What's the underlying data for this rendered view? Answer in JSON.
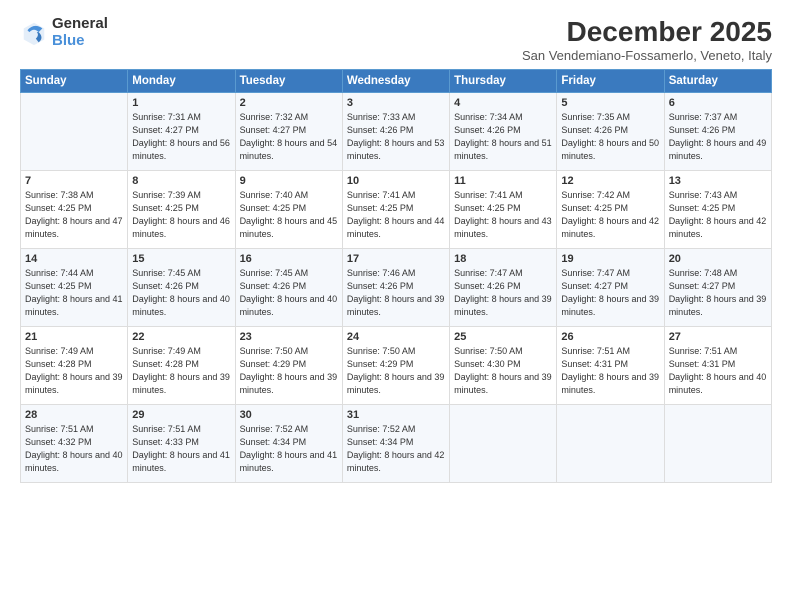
{
  "header": {
    "logo_general": "General",
    "logo_blue": "Blue",
    "month_title": "December 2025",
    "location": "San Vendemiano-Fossamerlo, Veneto, Italy"
  },
  "days_of_week": [
    "Sunday",
    "Monday",
    "Tuesday",
    "Wednesday",
    "Thursday",
    "Friday",
    "Saturday"
  ],
  "weeks": [
    [
      {
        "day": "",
        "sunrise": "",
        "sunset": "",
        "daylight": ""
      },
      {
        "day": "1",
        "sunrise": "7:31 AM",
        "sunset": "4:27 PM",
        "daylight": "8 hours and 56 minutes."
      },
      {
        "day": "2",
        "sunrise": "7:32 AM",
        "sunset": "4:27 PM",
        "daylight": "8 hours and 54 minutes."
      },
      {
        "day": "3",
        "sunrise": "7:33 AM",
        "sunset": "4:26 PM",
        "daylight": "8 hours and 53 minutes."
      },
      {
        "day": "4",
        "sunrise": "7:34 AM",
        "sunset": "4:26 PM",
        "daylight": "8 hours and 51 minutes."
      },
      {
        "day": "5",
        "sunrise": "7:35 AM",
        "sunset": "4:26 PM",
        "daylight": "8 hours and 50 minutes."
      },
      {
        "day": "6",
        "sunrise": "7:37 AM",
        "sunset": "4:26 PM",
        "daylight": "8 hours and 49 minutes."
      }
    ],
    [
      {
        "day": "7",
        "sunrise": "7:38 AM",
        "sunset": "4:25 PM",
        "daylight": "8 hours and 47 minutes."
      },
      {
        "day": "8",
        "sunrise": "7:39 AM",
        "sunset": "4:25 PM",
        "daylight": "8 hours and 46 minutes."
      },
      {
        "day": "9",
        "sunrise": "7:40 AM",
        "sunset": "4:25 PM",
        "daylight": "8 hours and 45 minutes."
      },
      {
        "day": "10",
        "sunrise": "7:41 AM",
        "sunset": "4:25 PM",
        "daylight": "8 hours and 44 minutes."
      },
      {
        "day": "11",
        "sunrise": "7:41 AM",
        "sunset": "4:25 PM",
        "daylight": "8 hours and 43 minutes."
      },
      {
        "day": "12",
        "sunrise": "7:42 AM",
        "sunset": "4:25 PM",
        "daylight": "8 hours and 42 minutes."
      },
      {
        "day": "13",
        "sunrise": "7:43 AM",
        "sunset": "4:25 PM",
        "daylight": "8 hours and 42 minutes."
      }
    ],
    [
      {
        "day": "14",
        "sunrise": "7:44 AM",
        "sunset": "4:25 PM",
        "daylight": "8 hours and 41 minutes."
      },
      {
        "day": "15",
        "sunrise": "7:45 AM",
        "sunset": "4:26 PM",
        "daylight": "8 hours and 40 minutes."
      },
      {
        "day": "16",
        "sunrise": "7:45 AM",
        "sunset": "4:26 PM",
        "daylight": "8 hours and 40 minutes."
      },
      {
        "day": "17",
        "sunrise": "7:46 AM",
        "sunset": "4:26 PM",
        "daylight": "8 hours and 39 minutes."
      },
      {
        "day": "18",
        "sunrise": "7:47 AM",
        "sunset": "4:26 PM",
        "daylight": "8 hours and 39 minutes."
      },
      {
        "day": "19",
        "sunrise": "7:47 AM",
        "sunset": "4:27 PM",
        "daylight": "8 hours and 39 minutes."
      },
      {
        "day": "20",
        "sunrise": "7:48 AM",
        "sunset": "4:27 PM",
        "daylight": "8 hours and 39 minutes."
      }
    ],
    [
      {
        "day": "21",
        "sunrise": "7:49 AM",
        "sunset": "4:28 PM",
        "daylight": "8 hours and 39 minutes."
      },
      {
        "day": "22",
        "sunrise": "7:49 AM",
        "sunset": "4:28 PM",
        "daylight": "8 hours and 39 minutes."
      },
      {
        "day": "23",
        "sunrise": "7:50 AM",
        "sunset": "4:29 PM",
        "daylight": "8 hours and 39 minutes."
      },
      {
        "day": "24",
        "sunrise": "7:50 AM",
        "sunset": "4:29 PM",
        "daylight": "8 hours and 39 minutes."
      },
      {
        "day": "25",
        "sunrise": "7:50 AM",
        "sunset": "4:30 PM",
        "daylight": "8 hours and 39 minutes."
      },
      {
        "day": "26",
        "sunrise": "7:51 AM",
        "sunset": "4:31 PM",
        "daylight": "8 hours and 39 minutes."
      },
      {
        "day": "27",
        "sunrise": "7:51 AM",
        "sunset": "4:31 PM",
        "daylight": "8 hours and 40 minutes."
      }
    ],
    [
      {
        "day": "28",
        "sunrise": "7:51 AM",
        "sunset": "4:32 PM",
        "daylight": "8 hours and 40 minutes."
      },
      {
        "day": "29",
        "sunrise": "7:51 AM",
        "sunset": "4:33 PM",
        "daylight": "8 hours and 41 minutes."
      },
      {
        "day": "30",
        "sunrise": "7:52 AM",
        "sunset": "4:34 PM",
        "daylight": "8 hours and 41 minutes."
      },
      {
        "day": "31",
        "sunrise": "7:52 AM",
        "sunset": "4:34 PM",
        "daylight": "8 hours and 42 minutes."
      },
      {
        "day": "",
        "sunrise": "",
        "sunset": "",
        "daylight": ""
      },
      {
        "day": "",
        "sunrise": "",
        "sunset": "",
        "daylight": ""
      },
      {
        "day": "",
        "sunrise": "",
        "sunset": "",
        "daylight": ""
      }
    ]
  ]
}
